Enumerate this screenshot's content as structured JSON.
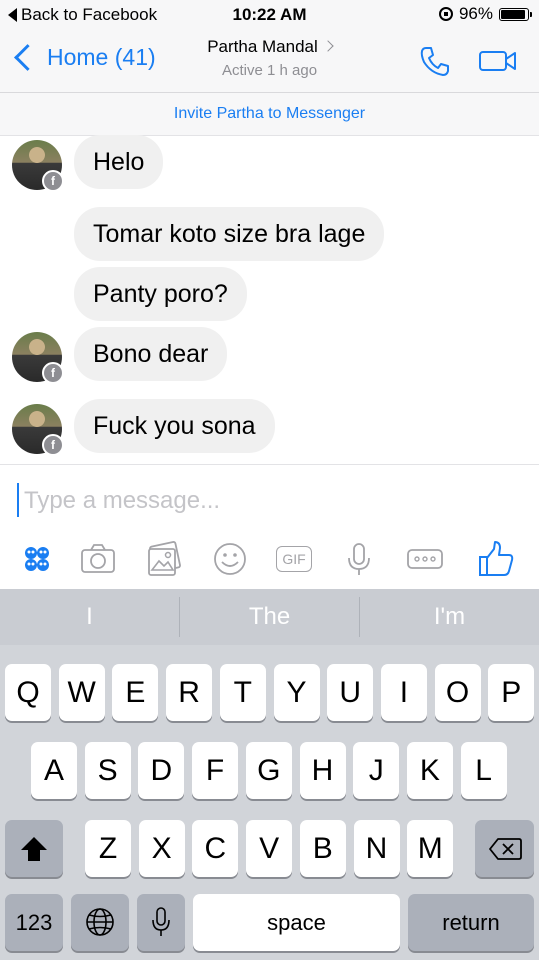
{
  "status_bar": {
    "back_label": "Back to Facebook",
    "time": "10:22 AM",
    "battery_text": "96%",
    "battery_level": 0.96
  },
  "nav": {
    "back_label": "Home (41)",
    "contact_name": "Partha Mandal",
    "subtitle": "Active 1 h ago"
  },
  "invite_text": "Invite Partha to Messenger",
  "messages": [
    {
      "text": "Helo",
      "avatar": true
    },
    {
      "text": "Tomar koto size bra lage",
      "avatar": false
    },
    {
      "text": "Panty poro?",
      "avatar": false
    },
    {
      "text": "Bono dear",
      "avatar": true
    },
    {
      "text": "Fuck you sona",
      "avatar": true
    }
  ],
  "composer": {
    "placeholder": "Type a message...",
    "tools": [
      "apps-icon",
      "camera-icon",
      "gallery-icon",
      "emoji-icon",
      "gif-icon",
      "microphone-icon",
      "more-icon",
      "like-icon"
    ],
    "gif_label": "GIF"
  },
  "keyboard": {
    "predictions": [
      "I",
      "The",
      "I'm"
    ],
    "row1": [
      "Q",
      "W",
      "E",
      "R",
      "T",
      "Y",
      "U",
      "I",
      "O",
      "P"
    ],
    "row2": [
      "A",
      "S",
      "D",
      "F",
      "G",
      "H",
      "J",
      "K",
      "L"
    ],
    "row3": [
      "Z",
      "X",
      "C",
      "V",
      "B",
      "N",
      "M"
    ],
    "numbers_label": "123",
    "space_label": "space",
    "return_label": "return"
  },
  "colors": {
    "accent": "#1a7ef2",
    "bubble": "#f0f0f0",
    "keyboard_bg": "#d1d4d9"
  }
}
